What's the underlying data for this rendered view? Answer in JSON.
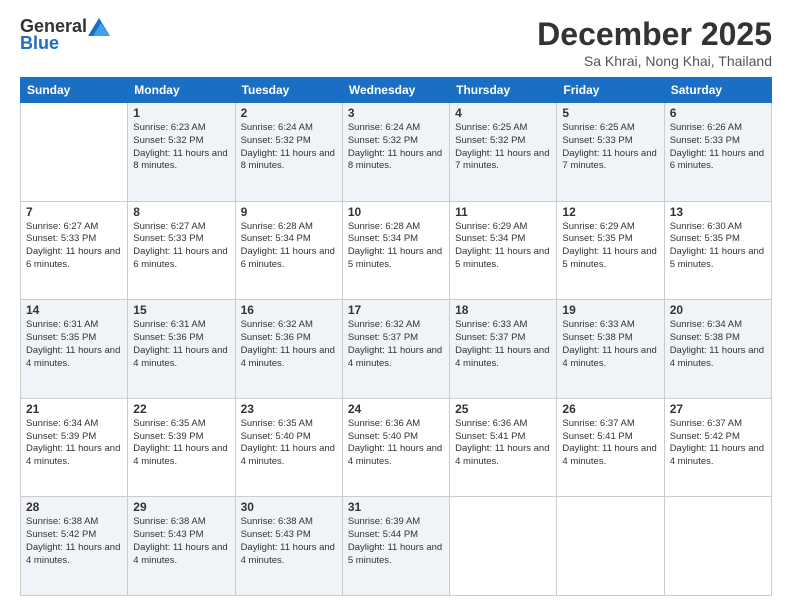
{
  "logo": {
    "general": "General",
    "blue": "Blue"
  },
  "title": "December 2025",
  "location": "Sa Khrai, Nong Khai, Thailand",
  "weekdays": [
    "Sunday",
    "Monday",
    "Tuesday",
    "Wednesday",
    "Thursday",
    "Friday",
    "Saturday"
  ],
  "weeks": [
    [
      {
        "day": "",
        "sunrise": "",
        "sunset": "",
        "daylight": ""
      },
      {
        "day": "1",
        "sunrise": "Sunrise: 6:23 AM",
        "sunset": "Sunset: 5:32 PM",
        "daylight": "Daylight: 11 hours and 8 minutes."
      },
      {
        "day": "2",
        "sunrise": "Sunrise: 6:24 AM",
        "sunset": "Sunset: 5:32 PM",
        "daylight": "Daylight: 11 hours and 8 minutes."
      },
      {
        "day": "3",
        "sunrise": "Sunrise: 6:24 AM",
        "sunset": "Sunset: 5:32 PM",
        "daylight": "Daylight: 11 hours and 8 minutes."
      },
      {
        "day": "4",
        "sunrise": "Sunrise: 6:25 AM",
        "sunset": "Sunset: 5:32 PM",
        "daylight": "Daylight: 11 hours and 7 minutes."
      },
      {
        "day": "5",
        "sunrise": "Sunrise: 6:25 AM",
        "sunset": "Sunset: 5:33 PM",
        "daylight": "Daylight: 11 hours and 7 minutes."
      },
      {
        "day": "6",
        "sunrise": "Sunrise: 6:26 AM",
        "sunset": "Sunset: 5:33 PM",
        "daylight": "Daylight: 11 hours and 6 minutes."
      }
    ],
    [
      {
        "day": "7",
        "sunrise": "Sunrise: 6:27 AM",
        "sunset": "Sunset: 5:33 PM",
        "daylight": "Daylight: 11 hours and 6 minutes."
      },
      {
        "day": "8",
        "sunrise": "Sunrise: 6:27 AM",
        "sunset": "Sunset: 5:33 PM",
        "daylight": "Daylight: 11 hours and 6 minutes."
      },
      {
        "day": "9",
        "sunrise": "Sunrise: 6:28 AM",
        "sunset": "Sunset: 5:34 PM",
        "daylight": "Daylight: 11 hours and 6 minutes."
      },
      {
        "day": "10",
        "sunrise": "Sunrise: 6:28 AM",
        "sunset": "Sunset: 5:34 PM",
        "daylight": "Daylight: 11 hours and 5 minutes."
      },
      {
        "day": "11",
        "sunrise": "Sunrise: 6:29 AM",
        "sunset": "Sunset: 5:34 PM",
        "daylight": "Daylight: 11 hours and 5 minutes."
      },
      {
        "day": "12",
        "sunrise": "Sunrise: 6:29 AM",
        "sunset": "Sunset: 5:35 PM",
        "daylight": "Daylight: 11 hours and 5 minutes."
      },
      {
        "day": "13",
        "sunrise": "Sunrise: 6:30 AM",
        "sunset": "Sunset: 5:35 PM",
        "daylight": "Daylight: 11 hours and 5 minutes."
      }
    ],
    [
      {
        "day": "14",
        "sunrise": "Sunrise: 6:31 AM",
        "sunset": "Sunset: 5:35 PM",
        "daylight": "Daylight: 11 hours and 4 minutes."
      },
      {
        "day": "15",
        "sunrise": "Sunrise: 6:31 AM",
        "sunset": "Sunset: 5:36 PM",
        "daylight": "Daylight: 11 hours and 4 minutes."
      },
      {
        "day": "16",
        "sunrise": "Sunrise: 6:32 AM",
        "sunset": "Sunset: 5:36 PM",
        "daylight": "Daylight: 11 hours and 4 minutes."
      },
      {
        "day": "17",
        "sunrise": "Sunrise: 6:32 AM",
        "sunset": "Sunset: 5:37 PM",
        "daylight": "Daylight: 11 hours and 4 minutes."
      },
      {
        "day": "18",
        "sunrise": "Sunrise: 6:33 AM",
        "sunset": "Sunset: 5:37 PM",
        "daylight": "Daylight: 11 hours and 4 minutes."
      },
      {
        "day": "19",
        "sunrise": "Sunrise: 6:33 AM",
        "sunset": "Sunset: 5:38 PM",
        "daylight": "Daylight: 11 hours and 4 minutes."
      },
      {
        "day": "20",
        "sunrise": "Sunrise: 6:34 AM",
        "sunset": "Sunset: 5:38 PM",
        "daylight": "Daylight: 11 hours and 4 minutes."
      }
    ],
    [
      {
        "day": "21",
        "sunrise": "Sunrise: 6:34 AM",
        "sunset": "Sunset: 5:39 PM",
        "daylight": "Daylight: 11 hours and 4 minutes."
      },
      {
        "day": "22",
        "sunrise": "Sunrise: 6:35 AM",
        "sunset": "Sunset: 5:39 PM",
        "daylight": "Daylight: 11 hours and 4 minutes."
      },
      {
        "day": "23",
        "sunrise": "Sunrise: 6:35 AM",
        "sunset": "Sunset: 5:40 PM",
        "daylight": "Daylight: 11 hours and 4 minutes."
      },
      {
        "day": "24",
        "sunrise": "Sunrise: 6:36 AM",
        "sunset": "Sunset: 5:40 PM",
        "daylight": "Daylight: 11 hours and 4 minutes."
      },
      {
        "day": "25",
        "sunrise": "Sunrise: 6:36 AM",
        "sunset": "Sunset: 5:41 PM",
        "daylight": "Daylight: 11 hours and 4 minutes."
      },
      {
        "day": "26",
        "sunrise": "Sunrise: 6:37 AM",
        "sunset": "Sunset: 5:41 PM",
        "daylight": "Daylight: 11 hours and 4 minutes."
      },
      {
        "day": "27",
        "sunrise": "Sunrise: 6:37 AM",
        "sunset": "Sunset: 5:42 PM",
        "daylight": "Daylight: 11 hours and 4 minutes."
      }
    ],
    [
      {
        "day": "28",
        "sunrise": "Sunrise: 6:38 AM",
        "sunset": "Sunset: 5:42 PM",
        "daylight": "Daylight: 11 hours and 4 minutes."
      },
      {
        "day": "29",
        "sunrise": "Sunrise: 6:38 AM",
        "sunset": "Sunset: 5:43 PM",
        "daylight": "Daylight: 11 hours and 4 minutes."
      },
      {
        "day": "30",
        "sunrise": "Sunrise: 6:38 AM",
        "sunset": "Sunset: 5:43 PM",
        "daylight": "Daylight: 11 hours and 4 minutes."
      },
      {
        "day": "31",
        "sunrise": "Sunrise: 6:39 AM",
        "sunset": "Sunset: 5:44 PM",
        "daylight": "Daylight: 11 hours and 5 minutes."
      },
      {
        "day": "",
        "sunrise": "",
        "sunset": "",
        "daylight": ""
      },
      {
        "day": "",
        "sunrise": "",
        "sunset": "",
        "daylight": ""
      },
      {
        "day": "",
        "sunrise": "",
        "sunset": "",
        "daylight": ""
      }
    ]
  ]
}
